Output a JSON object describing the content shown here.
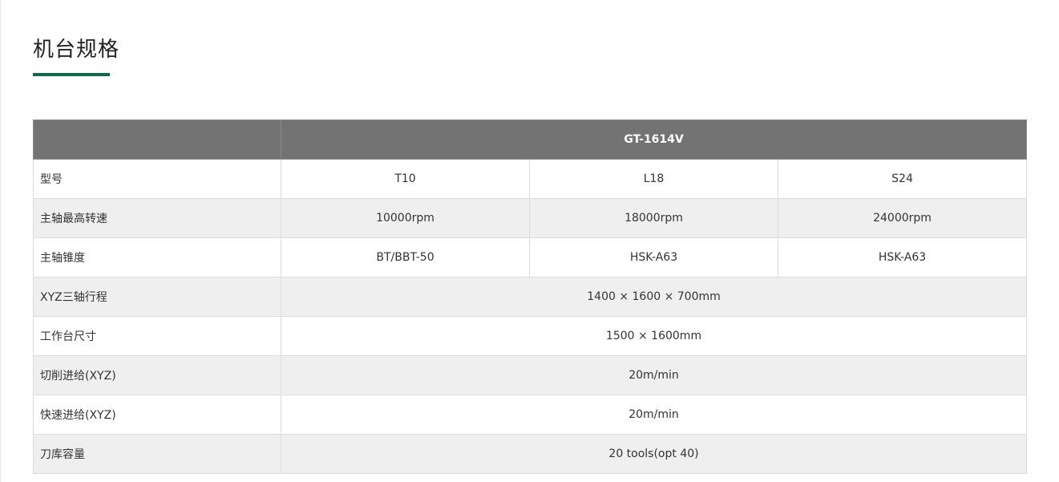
{
  "section": {
    "title": "机台规格"
  },
  "table": {
    "model_header": "GT-1614V",
    "rows": [
      {
        "label": "型号",
        "values": [
          "T10",
          "L18",
          "S24"
        ]
      },
      {
        "label": "主轴最高转速",
        "values": [
          "10000rpm",
          "18000rpm",
          "24000rpm"
        ]
      },
      {
        "label": "主轴锥度",
        "values": [
          "BT/BBT-50",
          "HSK-A63",
          "HSK-A63"
        ]
      },
      {
        "label": "XYZ三轴行程",
        "value": "1400 × 1600 × 700mm"
      },
      {
        "label": "工作台尺寸",
        "value": "1500 × 1600mm"
      },
      {
        "label": "切削进给(XYZ)",
        "value": "20m/min"
      },
      {
        "label": "快速进给(XYZ)",
        "value": "20m/min"
      },
      {
        "label": "刀库容量",
        "value": "20 tools(opt 40)"
      }
    ]
  },
  "colors": {
    "accent": "#0f6b45",
    "header_bg": "#737373",
    "stripe_bg": "#efefef"
  }
}
